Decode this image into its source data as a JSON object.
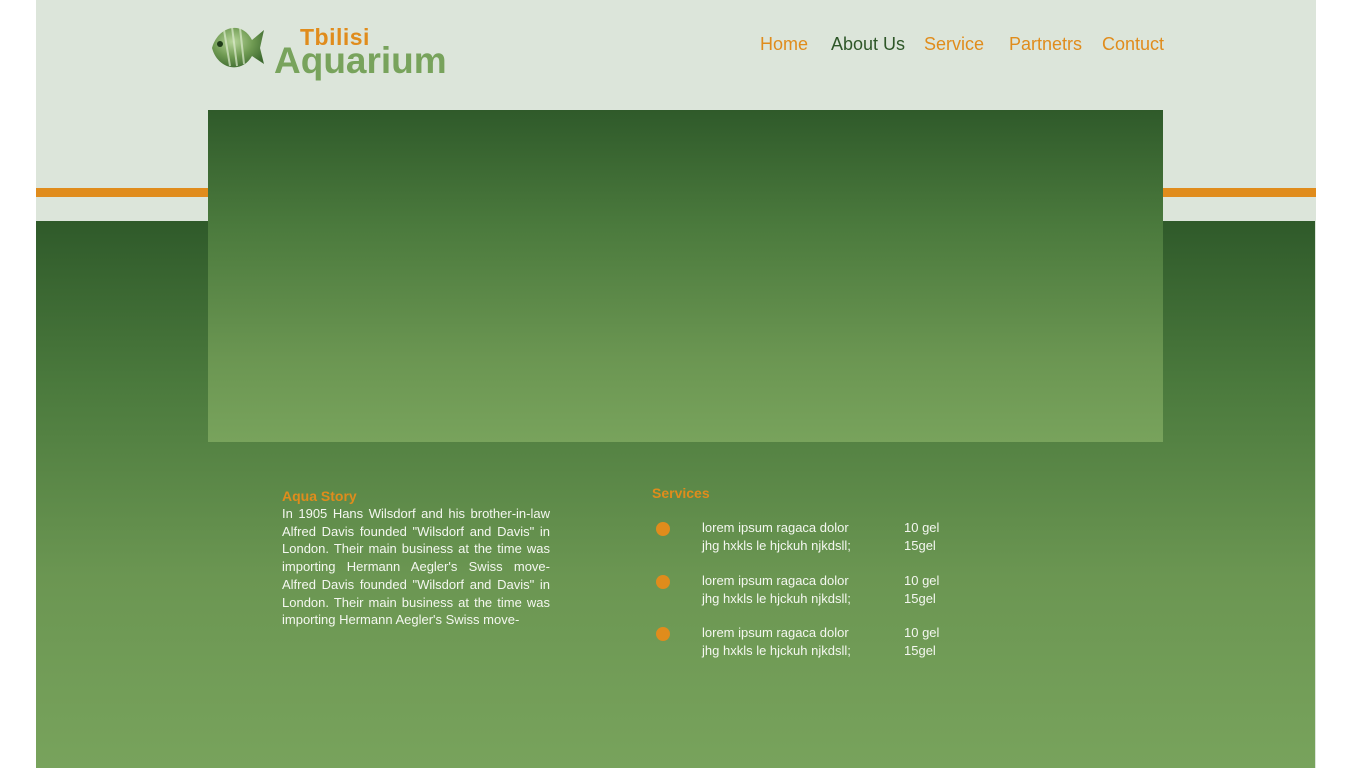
{
  "logo": {
    "line1": "Tbilisi",
    "line2": "Aquarium",
    "icon": "fish-icon"
  },
  "nav": {
    "items": [
      {
        "label": "Home",
        "active": false
      },
      {
        "label": "About Us",
        "active": true
      },
      {
        "label": "Service",
        "active": false
      },
      {
        "label": "Partnetrs",
        "active": false
      },
      {
        "label": "Contuct",
        "active": false
      }
    ]
  },
  "story": {
    "title": "Aqua Story",
    "body": "In 1905 Hans Wilsdorf and his brother-in-law Alfred Davis founded \"Wilsdorf and Davis\" in London. Their main business at the time was importing Hermann Aegler's Swiss move-Alfred Davis founded \"Wilsdorf and Davis\" in London. Their main business at the time was importing Hermann Aegler's Swiss move-"
  },
  "services": {
    "title": "Services",
    "items": [
      {
        "desc1": "lorem ipsum ragaca dolor",
        "desc2": "jhg hxkls le hjckuh njkdsll;",
        "price1": "10 gel",
        "price2": "15gel"
      },
      {
        "desc1": "lorem ipsum ragaca dolor",
        "desc2": "jhg hxkls le hjckuh njkdsll;",
        "price1": "10 gel",
        "price2": "15gel"
      },
      {
        "desc1": "lorem ipsum ragaca dolor",
        "desc2": "jhg hxkls le hjckuh njkdsll;",
        "price1": "10 gel",
        "price2": "15gel"
      }
    ]
  },
  "colors": {
    "accent": "#e08c1c",
    "dark_green": "#2e5728",
    "light_green": "#78a35c",
    "page_bg": "#dce5da"
  }
}
